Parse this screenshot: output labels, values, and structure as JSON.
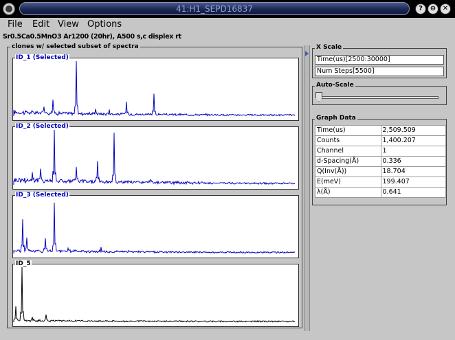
{
  "window": {
    "title": "41:H1_SEPD16837"
  },
  "menu": [
    "File",
    "Edit",
    "View",
    "Options"
  ],
  "subtitle": "Sr0.5Ca0.5MnO3 Ar1200 (20hr), A500 s,c displex rt",
  "clones": {
    "title": "clones w/ selected subset of spectra",
    "plots": [
      {
        "label": "ID_1 (Selected)",
        "color": "#0000bb"
      },
      {
        "label": "ID_2 (Selected)",
        "color": "#0000bb"
      },
      {
        "label": "ID_3 (Selected)",
        "color": "#0000bb"
      },
      {
        "label": "ID_5",
        "color": "#000000"
      }
    ]
  },
  "xscale": {
    "title": "X Scale",
    "time_range": "Time(us)[2500:30000]",
    "num_steps": "Num Steps[5500]"
  },
  "autoscale": {
    "title": "Auto-Scale",
    "level": 0
  },
  "graph_data": {
    "title": "Graph Data",
    "rows": [
      {
        "key": "Time(us)",
        "value": "2,509.509"
      },
      {
        "key": "Counts",
        "value": "1,400.207"
      },
      {
        "key": "Channel",
        "value": "1"
      },
      {
        "key": "d-Spacing(Å)",
        "value": "0.336"
      },
      {
        "key": "Q(Inv(Å))",
        "value": "18.704"
      },
      {
        "key": "E(meV)",
        "value": "199.407"
      },
      {
        "key": "λ(Å)",
        "value": "0.641"
      }
    ]
  }
}
